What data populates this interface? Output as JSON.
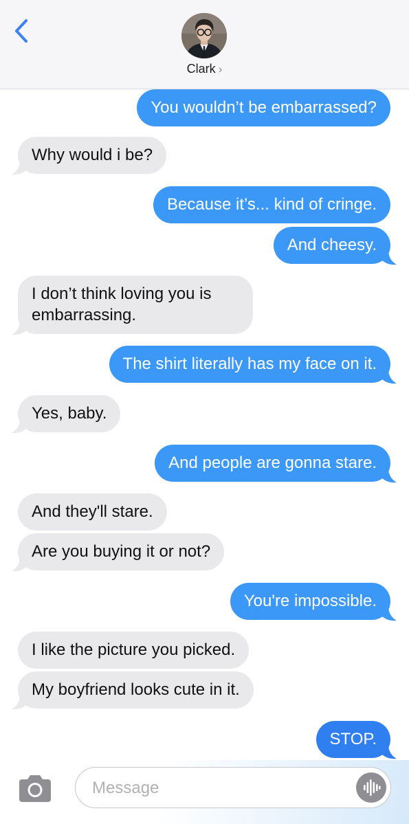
{
  "header": {
    "contact_name": "Clark",
    "name_chevron": "›",
    "back_icon": "chevron-left-icon",
    "accent_color": "#3b82f6"
  },
  "messages": [
    {
      "direction": "outgoing",
      "text": "You wouldn’t be embarrassed?"
    },
    {
      "direction": "incoming",
      "text": "Why would i be?"
    },
    {
      "direction": "outgoing",
      "text": "Because it’s... kind of cringe."
    },
    {
      "direction": "outgoing",
      "text": "And cheesy."
    },
    {
      "direction": "incoming",
      "text": "I don’t think loving you is embarrassing."
    },
    {
      "direction": "outgoing",
      "text": "The shirt literally has my face on it."
    },
    {
      "direction": "incoming",
      "text": "Yes, baby."
    },
    {
      "direction": "outgoing",
      "text": "And people are gonna stare."
    },
    {
      "direction": "incoming",
      "text": "And they'll stare."
    },
    {
      "direction": "incoming",
      "text": "Are you buying it or not?"
    },
    {
      "direction": "outgoing",
      "text": "You're impossible."
    },
    {
      "direction": "incoming",
      "text": "I like the picture you picked."
    },
    {
      "direction": "incoming",
      "text": "My boyfriend looks cute in it."
    },
    {
      "direction": "outgoing",
      "text": "STOP."
    }
  ],
  "input_bar": {
    "placeholder": "Message",
    "camera_icon": "camera-icon",
    "audio_icon": "audio-waveform-icon"
  },
  "colors": {
    "outgoing_bubble": "#3b98f6",
    "incoming_bubble": "#e9e9eb",
    "header_background": "#f6f6f8"
  }
}
